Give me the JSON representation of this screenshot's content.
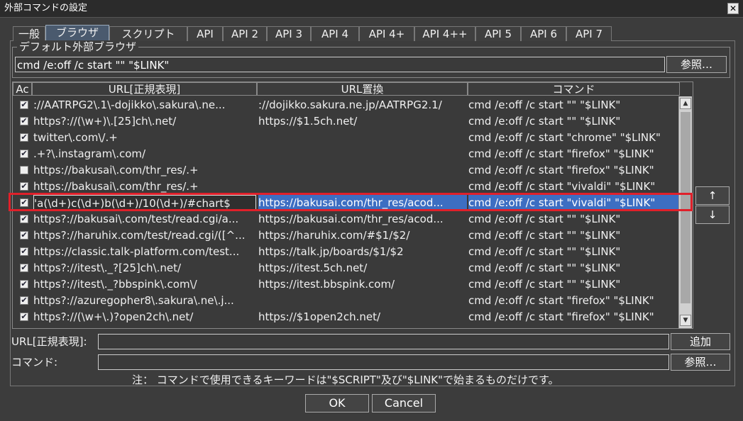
{
  "window": {
    "title": "外部コマンドの設定",
    "close_glyph": "✕"
  },
  "tabs": [
    {
      "label": "一般"
    },
    {
      "label": "ブラウザ"
    },
    {
      "label": "スクリプト"
    },
    {
      "label": "API"
    },
    {
      "label": "API 2"
    },
    {
      "label": "API 3"
    },
    {
      "label": "API 4"
    },
    {
      "label": "API 4+"
    },
    {
      "label": "API 4++"
    },
    {
      "label": "API 5"
    },
    {
      "label": "API 6"
    },
    {
      "label": "API 7"
    }
  ],
  "default_browser": {
    "legend": "デフォルト外部ブラウザ",
    "value": "cmd /e:off /c start \"\" \"$LINK\"",
    "browse_label": "参照…"
  },
  "list": {
    "headers": [
      "Ac",
      "URL[正規表現]",
      "URL置換",
      "コマンド"
    ],
    "rows": [
      {
        "checked": true,
        "url": "://AATRPG2\\.1\\-dojikko\\.sakura\\.ne...",
        "replace": "://dojikko.sakura.ne.jp/AATRPG2.1/",
        "command": "cmd /e:off /c start \"\" \"$LINK\""
      },
      {
        "checked": true,
        "url": "https?://(\\w+)\\.[25]ch\\.net/",
        "replace": "https://$1.5ch.net/",
        "command": "cmd /e:off /c start \"\" \"$LINK\""
      },
      {
        "checked": true,
        "url": "twitter\\.com\\/.+",
        "replace": "",
        "command": "cmd /e:off /c start \"chrome\" \"$LINK\""
      },
      {
        "checked": true,
        "url": ".+?\\.instagram\\.com/",
        "replace": "",
        "command": "cmd /e:off /c start \"firefox\" \"$LINK\""
      },
      {
        "checked": false,
        "url": "https://bakusai\\.com/thr_res/.+",
        "replace": "",
        "command": "cmd /e:off /c start \"firefox\" \"$LINK\""
      },
      {
        "checked": true,
        "url": "https://bakusai\\.com/thr_res/.+",
        "replace": "",
        "command": "cmd /e:off /c start \"vivaldi\" \"$LINK\""
      },
      {
        "checked": true,
        "url": "'a(\\d+)c(\\d+)b(\\d+)/10(\\d+)/#chart$",
        "replace": "https://bakusai.com/thr_res/acod...",
        "command": "cmd /e:off /c start \"vivaldi\" \"$LINK\"",
        "selected": true
      },
      {
        "checked": true,
        "url": "https?://bakusai\\.com/test/read.cgi/a...",
        "replace": "https://bakusai.com/thr_res/acod...",
        "command": "cmd /e:off /c start \"\" \"$LINK\""
      },
      {
        "checked": true,
        "url": "https?://haruhix.com/test/read.cgi/([^...",
        "replace": "https://haruhix.com/#$1/$2/",
        "command": "cmd /e:off /c start \"\" \"$LINK\""
      },
      {
        "checked": true,
        "url": "https://classic.talk-platform.com/test...",
        "replace": "https://talk.jp/boards/$1/$2",
        "command": "cmd /e:off /c start \"\" \"$LINK\""
      },
      {
        "checked": true,
        "url": "https?://itest\\._?[25]ch\\.net/",
        "replace": "https://itest.5ch.net/",
        "command": "cmd /e:off /c start \"\" \"$LINK\""
      },
      {
        "checked": true,
        "url": "https?://itest\\._?bbspink\\.com\\/",
        "replace": "https://itest.bbspink.com/",
        "command": "cmd /e:off /c start \"\" \"$LINK\""
      },
      {
        "checked": true,
        "url": "https?://azuregopher8\\.sakura\\.ne\\.j...",
        "replace": "",
        "command": "cmd /e:off /c start \"firefox\" \"$LINK\""
      },
      {
        "checked": true,
        "url": "https?://(\\w+\\.)?open2ch\\.net/",
        "replace": "https://$1open2ch.net/",
        "command": "cmd /e:off /c start \"firefox\" \"$LINK\""
      }
    ]
  },
  "move_up": "↑",
  "move_down": "↓",
  "url_field": {
    "label": "URL[正規表現]:",
    "value": "",
    "add_label": "追加"
  },
  "command_field": {
    "label": "コマンド:",
    "value": "",
    "browse_label": "参照…"
  },
  "note": "注： コマンドで使用できるキーワードは\"$SCRIPT\"及び\"$LINK\"で始まるものだけです。",
  "buttons": {
    "ok": "OK",
    "cancel": "Cancel"
  },
  "icons": {
    "check": "✔",
    "scroll_up": "▲",
    "scroll_down": "▼"
  }
}
